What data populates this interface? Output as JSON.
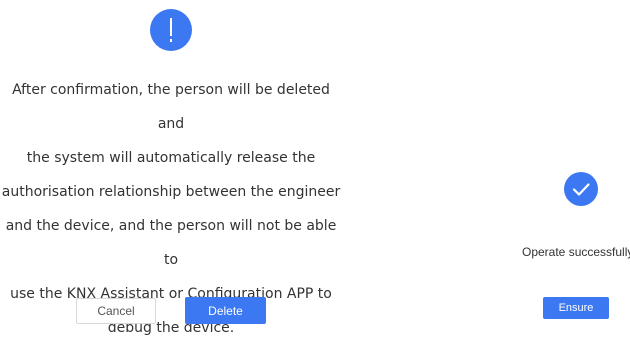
{
  "colors": {
    "accent": "#3b78f2",
    "text": "#333333",
    "border": "#d9d9d9",
    "background": "#ffffff"
  },
  "confirm_dialog": {
    "icon": "exclamation-icon",
    "message_lines": [
      "After confirmation, the person will be deleted and",
      "the system will automatically release the",
      "authorisation relationship between the engineer",
      "and the device, and the person will not be able to",
      "use the KNX Assistant or Configuration APP to",
      "debug the device."
    ],
    "cancel_label": "Cancel",
    "delete_label": "Delete"
  },
  "success_dialog": {
    "icon": "checkmark-icon",
    "message": "Operate successfully",
    "ensure_label": "Ensure"
  }
}
